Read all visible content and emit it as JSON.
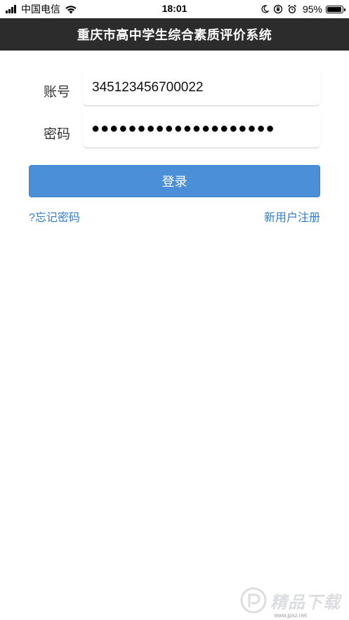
{
  "status_bar": {
    "carrier": "中国电信",
    "time": "18:01",
    "battery_percent": "95%",
    "icons": [
      "signal-icon",
      "wifi-icon",
      "moon-icon",
      "orientation-lock-icon",
      "alarm-icon",
      "battery-icon"
    ]
  },
  "header": {
    "title": "重庆市高中学生综合素质评价系统",
    "background": "#2c2c2c"
  },
  "form": {
    "account_label": "账号",
    "account_value": "345123456700022",
    "password_label": "密码",
    "password_mask": "●●●●●●●●●●●●●●●●●●●●",
    "login_label": "登录",
    "forgot_label": "?忘记密码",
    "register_label": "新用户注册"
  },
  "colors": {
    "accent": "#4a8fd8",
    "link": "#2f7dd3"
  },
  "watermark": {
    "text": "精品下载",
    "sub": "www.jpxz.net"
  }
}
